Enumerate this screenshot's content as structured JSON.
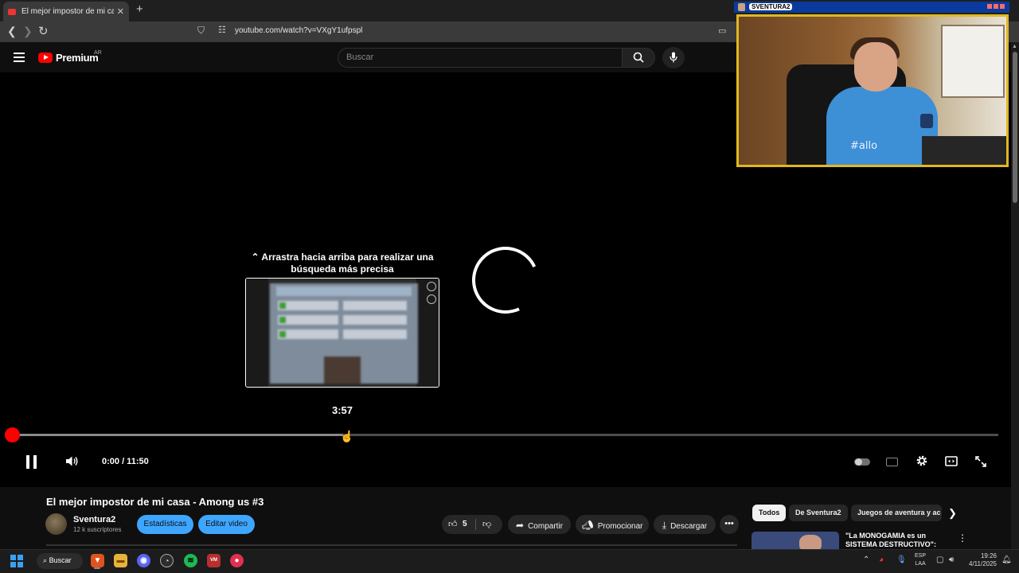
{
  "browser": {
    "tab_title": "El mejor impostor de mi casa - A",
    "tab_close": "✕",
    "new_tab": "+",
    "url": "youtube.com/watch?v=VXgY1ufpspl",
    "back": "❮",
    "forward": "❯",
    "reload": "↻"
  },
  "youtube_header": {
    "logo_text": "Premium",
    "region": "AR",
    "search_placeholder": "Buscar"
  },
  "stream_overlay": {
    "streamer_name": "SVENTURA2",
    "shirt_text": "#allo"
  },
  "player": {
    "seek_hint_line1": "⌃ Arrastra hacia arriba para realizar una",
    "seek_hint_line2": "búsqueda más precisa",
    "preview_time": "3:57",
    "time_display": "0:00 / 11:50",
    "progress_buffered": 0.335,
    "is_loading": true,
    "autoplay": false
  },
  "video": {
    "title": "El mejor impostor de mi casa - Among us #3",
    "channel": "Sventura2",
    "subscribers": "12 k suscriptores",
    "stats_button": "Estadísticas",
    "edit_button": "Editar video",
    "likes": "5",
    "share_label": "Compartir",
    "promote_label": "Promocionar",
    "download_label": "Descargar"
  },
  "sidebar": {
    "chips": [
      "Todos",
      "De Sventura2",
      "Juegos de aventura y ac"
    ],
    "rec_title": "\"La MONOGAMIA es un SISTEMA DESTRUCTIVO\": Nild"
  },
  "taskbar": {
    "search_label": "Buscar",
    "lang_line1": "ESP",
    "lang_line2": "LAA",
    "time": "19:26",
    "date": "4/11/2025"
  },
  "colors": {
    "accent_red": "#ff0000",
    "pill_blue": "#3ea6ff",
    "overlay_border": "#e0b820",
    "overlay_header": "#0a3a9c"
  }
}
